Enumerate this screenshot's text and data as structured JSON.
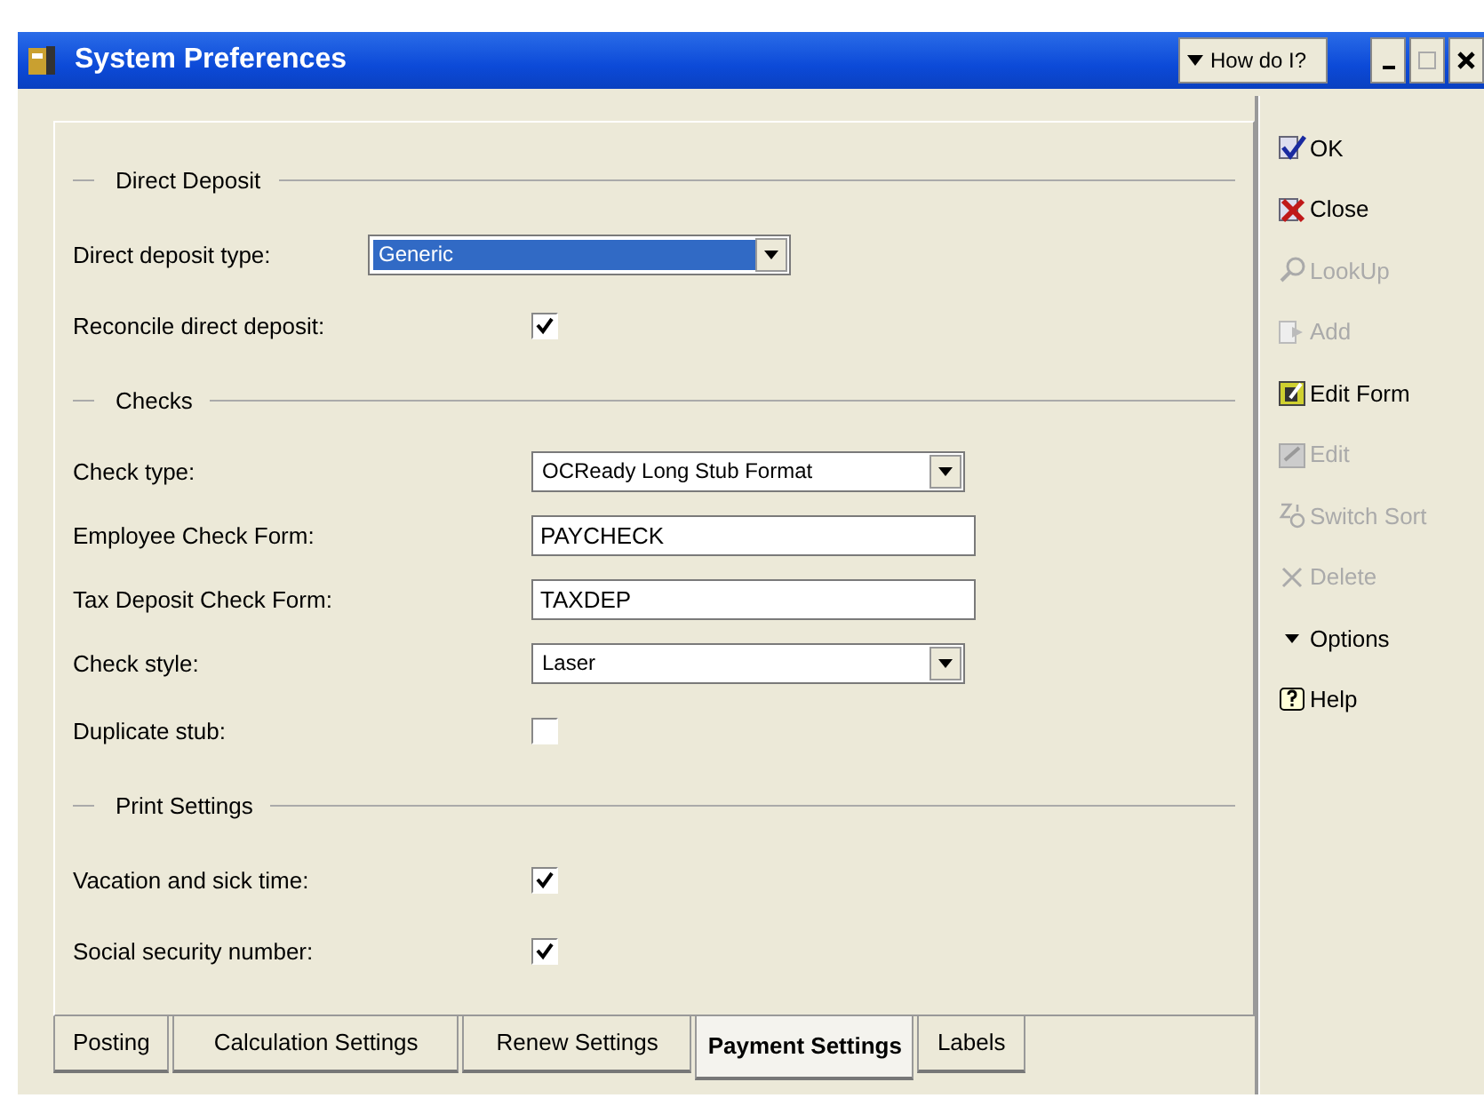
{
  "window": {
    "title": "System Preferences",
    "help_button": "How do I?"
  },
  "form": [
    {
      "kind": "section",
      "label": "Direct Deposit"
    },
    {
      "kind": "select",
      "label": "Direct deposit type:",
      "value": "Generic",
      "focused": true
    },
    {
      "kind": "checkbox",
      "label": "Reconcile direct deposit:",
      "checked": true
    },
    {
      "kind": "section",
      "label": "Checks"
    },
    {
      "kind": "select",
      "label": "Check type:",
      "value": "OCReady Long Stub Format",
      "focused": false
    },
    {
      "kind": "text",
      "label": "Employee Check Form:",
      "value": "PAYCHECK"
    },
    {
      "kind": "text",
      "label": "Tax Deposit Check Form:",
      "value": "TAXDEP"
    },
    {
      "kind": "select",
      "label": "Check style:",
      "value": "Laser",
      "focused": false
    },
    {
      "kind": "checkbox",
      "label": "Duplicate stub:",
      "checked": false
    },
    {
      "kind": "section",
      "label": "Print Settings"
    },
    {
      "kind": "checkbox",
      "label": "Vacation and sick time:",
      "checked": true
    },
    {
      "kind": "checkbox",
      "label": "Social security number:",
      "checked": true
    }
  ],
  "tabs": [
    {
      "label": "Posting",
      "selected": false
    },
    {
      "label": "Calculation Settings",
      "selected": false
    },
    {
      "label": "Renew Settings",
      "selected": false
    },
    {
      "label": "Payment Settings",
      "selected": true
    },
    {
      "label": "Labels",
      "selected": false
    }
  ],
  "toolbar": [
    {
      "label": "OK",
      "disabled": false
    },
    {
      "label": "Close",
      "disabled": false
    },
    {
      "label": "LookUp",
      "disabled": true
    },
    {
      "label": "Add",
      "disabled": true
    },
    {
      "label": "Edit Form",
      "disabled": false
    },
    {
      "label": "Edit",
      "disabled": true
    },
    {
      "label": "Switch Sort",
      "disabled": true
    },
    {
      "label": "Delete",
      "disabled": true
    },
    {
      "label": "Options",
      "disabled": false
    },
    {
      "label": "Help",
      "disabled": false
    }
  ]
}
